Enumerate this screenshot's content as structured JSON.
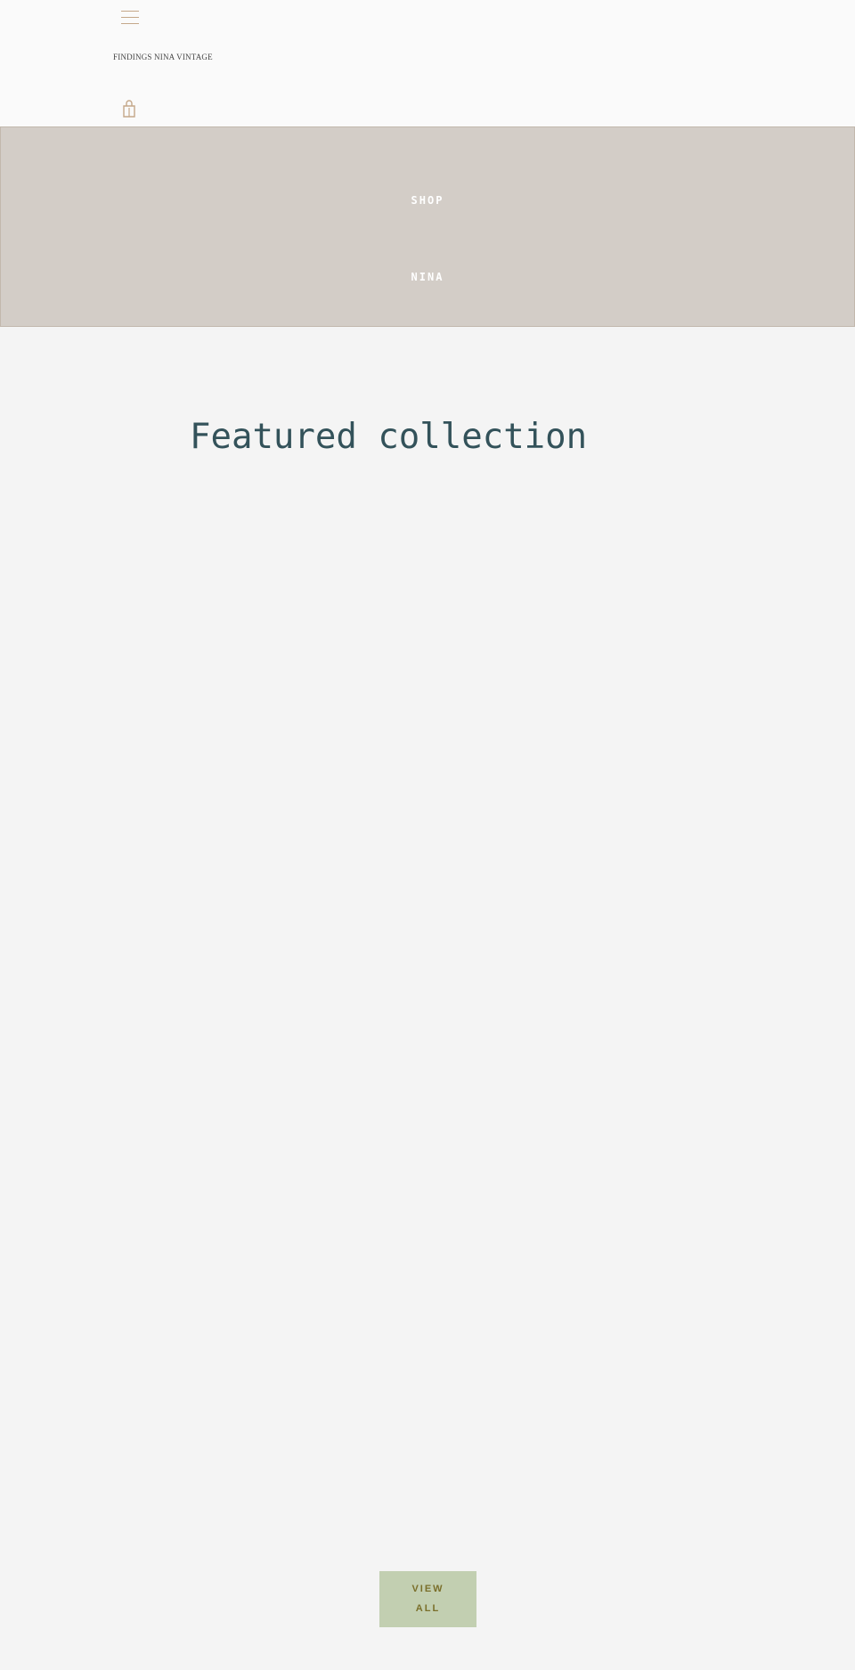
{
  "header": {
    "logo_text": "FINDINGS NINA VINTAGE",
    "menu_icon": "hamburger-menu-icon",
    "cart_icon": "shopping-bag-icon",
    "accent_color": "#c4a789"
  },
  "hero": {
    "line1": "SHOP",
    "line2": "NINA",
    "background_color": "#d3cdc7"
  },
  "featured": {
    "title": "Featured collection",
    "title_color": "#33525a"
  },
  "view_all": {
    "line1": "VIEW",
    "line2": "ALL",
    "background_color": "#c2cfb1"
  }
}
